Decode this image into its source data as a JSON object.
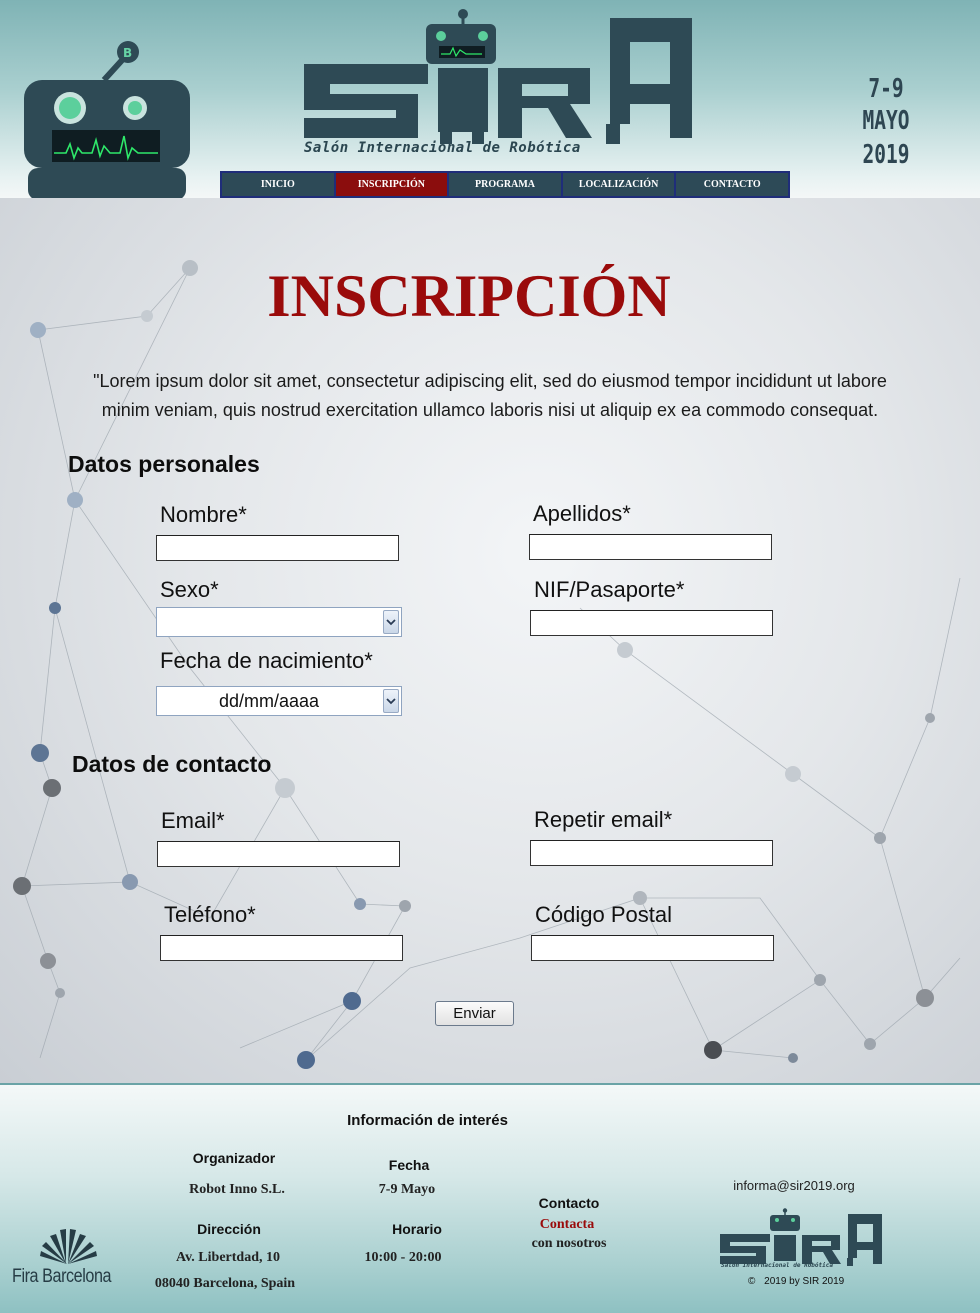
{
  "header": {
    "logo_subtitle": "Salón Internacional de Robótica",
    "date_days": "7-9",
    "date_month": "MAYO 2019",
    "nav": [
      "INICIO",
      "INSCRIPCIÓN",
      "PROGRAMA",
      "LOCALIZACIÓN",
      "CONTACTO"
    ],
    "active_nav": "INSCRIPCIÓN"
  },
  "main": {
    "title": "INSCRIPCIÓN",
    "intro_line1": "\"Lorem ipsum dolor sit amet, consectetur adipiscing elit, sed do eiusmod tempor incididunt ut labore",
    "intro_line2": "minim veniam, quis nostrud exercitation ullamco laboris nisi ut aliquip ex ea commodo consequat.",
    "personal": {
      "title": "Datos personales",
      "nombre": "Nombre*",
      "apellidos": "Apellidos*",
      "sexo": "Sexo*",
      "nif": "NIF/Pasaporte*",
      "fecha": "Fecha de nacimiento*",
      "fecha_value": "dd/mm/aaaa",
      "sexo_value": ""
    },
    "contact": {
      "title": "Datos de contacto",
      "email": "Email*",
      "repetir": "Repetir email*",
      "telefono": "Teléfono*",
      "cp": "Código Postal"
    },
    "submit": "Enviar"
  },
  "footer": {
    "heading": "Información de interés",
    "organizador_label": "Organizador",
    "organizador_value": "Robot Inno S.L.",
    "fecha_label": "Fecha",
    "fecha_value": "7-9 Mayo",
    "direccion_label": "Dirección",
    "direccion_line1": "Av. Libertdad, 10",
    "direccion_line2": "08040 Barcelona, Spain",
    "horario_label": "Horario",
    "horario_value": "10:00 - 20:00",
    "contacto_label": "Contacto",
    "contacto_link": "Contacta",
    "contacto_tail": "con nosotros",
    "email": "informa@sir2019.org",
    "fira": "Fira Barcelona",
    "footer_logo_sub": "Salón Internacional de Robótica",
    "copyright": "2019 by SIR 2019"
  },
  "colors": {
    "accent_red": "#9a0b0b",
    "nav_bg": "#2d4a57",
    "logo_dark": "#2e4a55"
  }
}
